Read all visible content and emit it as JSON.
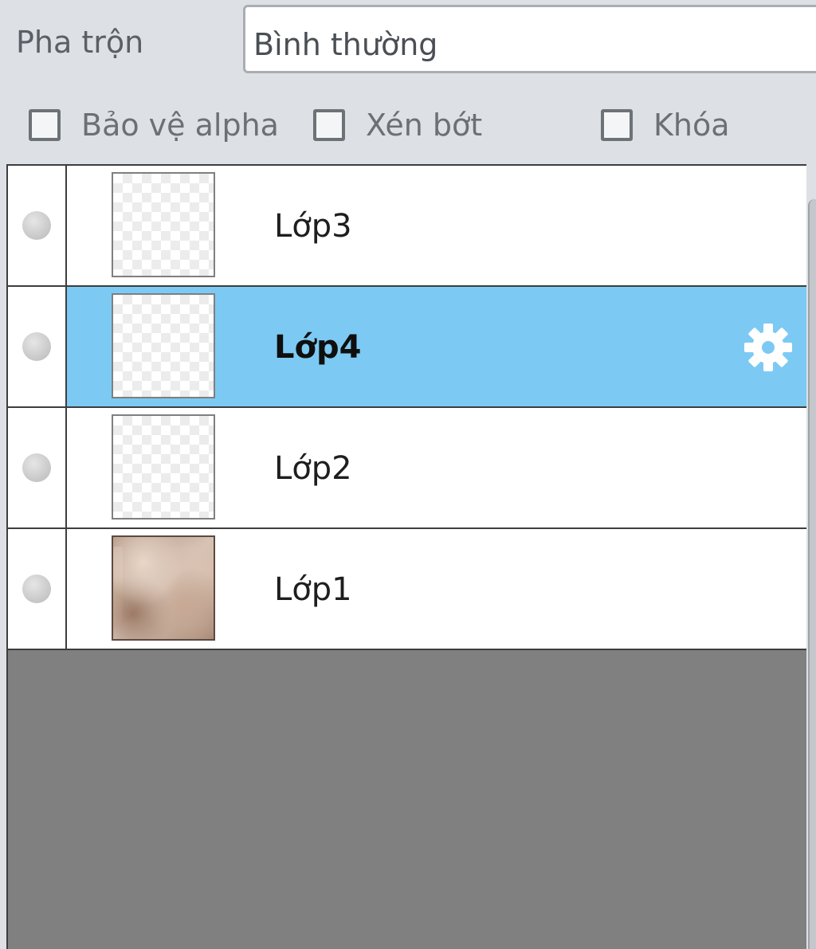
{
  "blend": {
    "label": "Pha trộn",
    "value": "Bình thường"
  },
  "options": [
    {
      "label": "Bảo vệ alpha",
      "checked": false
    },
    {
      "label": "Xén bớt",
      "checked": false
    },
    {
      "label": "Khóa",
      "checked": false
    }
  ],
  "layers": [
    {
      "name": "Lớp3",
      "selected": false,
      "thumbnail": "transparent",
      "visible": true
    },
    {
      "name": "Lớp4",
      "selected": true,
      "thumbnail": "transparent",
      "visible": true,
      "action_icon": "gear-icon"
    },
    {
      "name": "Lớp2",
      "selected": false,
      "thumbnail": "transparent",
      "visible": true
    },
    {
      "name": "Lớp1",
      "selected": false,
      "thumbnail": "photo",
      "visible": true
    }
  ],
  "colors": {
    "selected_row": "#7ccaf3",
    "panel_bg": "#dde1e5",
    "list_empty_bg": "#808080"
  }
}
